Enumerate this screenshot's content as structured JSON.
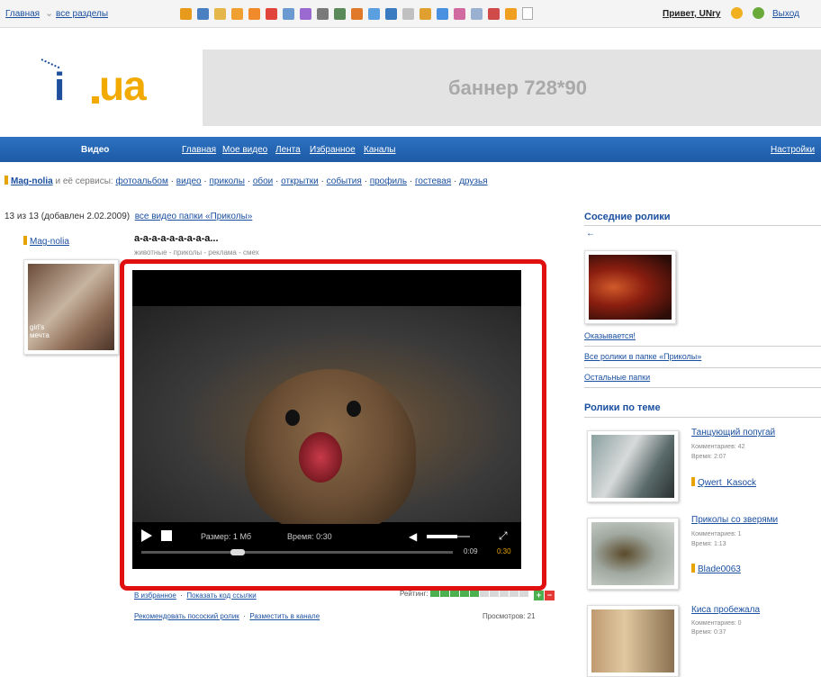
{
  "topbar": {
    "home": "Главная",
    "all_sections": "все разделы",
    "greeting": "Привет, UNry",
    "logout": "Выход"
  },
  "logo": {
    "i": "i",
    "ua": "ua"
  },
  "banner": {
    "text": "баннер 728*90"
  },
  "nav": {
    "section": "Видео",
    "items": [
      "Главная",
      "Мое видео",
      "Лента",
      "Избранное",
      "Каналы"
    ],
    "settings": "Настройки"
  },
  "user": {
    "name": "Mag-nolia",
    "services_label": "и её сервисы:",
    "services": [
      "фотоальбом",
      "видео",
      "приколы",
      "обои",
      "открытки",
      "события",
      "профиль",
      "гостевая",
      "друзья"
    ]
  },
  "info": {
    "counter": "13 из 13 (добавлен 2.02.2009)",
    "folder_link": "все видео папки «Приколы»"
  },
  "author": {
    "name": "Mag-nolia",
    "thumb_caption": "girl's мечта"
  },
  "video": {
    "title": "а-а-а-а-а-а-а-а-а...",
    "tags": "животные - приколы - реклама - смех"
  },
  "player": {
    "size": "Размер: 1 Мб",
    "duration": "Время: 0:30",
    "current_time": "0:09",
    "total_time": "0:30",
    "progress": 0.3,
    "volume": 0.7
  },
  "actions": {
    "favorite": "В избранное",
    "show_code": "Показать код ссылки",
    "recommend": "Рекомендовать посоский ролик",
    "post_channel": "Разместить в канале",
    "rating_label": "Рейтинг:",
    "rating_value": 5,
    "rating_max": 10,
    "views": "Просмотров: 21"
  },
  "right": {
    "neighbors_title": "Соседние ролики",
    "arrow": "←",
    "neighbor_link": "Оказывается!",
    "all_in_folder": "Все ролики в папке «Приколы»",
    "other_folders": "Остальные папки",
    "related_title": "Ролики по теме",
    "items": [
      {
        "title": "Танцующий попугай",
        "comments": "Комментариев: 42",
        "time": "Время: 2:07",
        "user": "Qwert_Kasock"
      },
      {
        "title": "Приколы со зверями",
        "comments": "Комментариев: 1",
        "time": "Время: 1:13",
        "user": "Blade0063"
      },
      {
        "title": "Киса пробежала",
        "comments": "Комментариев: 0",
        "time": "Время: 0:37",
        "user": ""
      }
    ]
  },
  "colors": {
    "nav_blue": "#1d5aa6",
    "link_blue": "#1a4fa0",
    "logo_orange": "#f2a900",
    "highlight_red": "#e01010",
    "rating_green": "#4caf50"
  }
}
